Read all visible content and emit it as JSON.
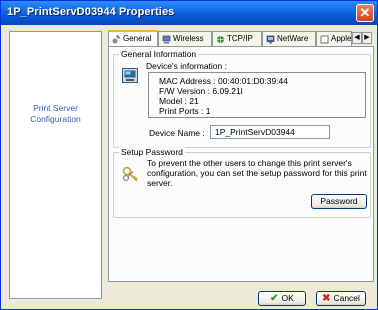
{
  "window": {
    "title": "1P_PrintServD03944 Properties"
  },
  "left_panel": {
    "label_line1": "Print Server",
    "label_line2": "Configuration"
  },
  "tabs": [
    {
      "label": "General",
      "icon": "wrench-gear-icon",
      "active": true
    },
    {
      "label": "Wireless",
      "icon": "wireless-icon"
    },
    {
      "label": "TCP/IP",
      "icon": "network-icon"
    },
    {
      "label": "NetWare",
      "icon": "netware-icon"
    },
    {
      "label": "Apple",
      "icon": "apple-icon"
    }
  ],
  "general_info": {
    "group_title": "General Information",
    "devices_info_label": "Device's information :",
    "mac_address": "MAC Address : 00:40:01:D0:39:44",
    "fw_version": "F/W Version : 6.09.21l",
    "model": "Model : 21",
    "print_ports": "Print Ports : 1",
    "device_name_label": "Device Name :",
    "device_name_value": "1P_PrintServD03944"
  },
  "setup_password": {
    "group_title": "Setup Password",
    "description_line1": "To prevent the other users to change this print server's",
    "description_line2": "configuration, you can set the setup password for this print",
    "description_line3": "server.",
    "password_button": "Password"
  },
  "footer": {
    "ok_label": "OK",
    "cancel_label": "Cancel"
  }
}
